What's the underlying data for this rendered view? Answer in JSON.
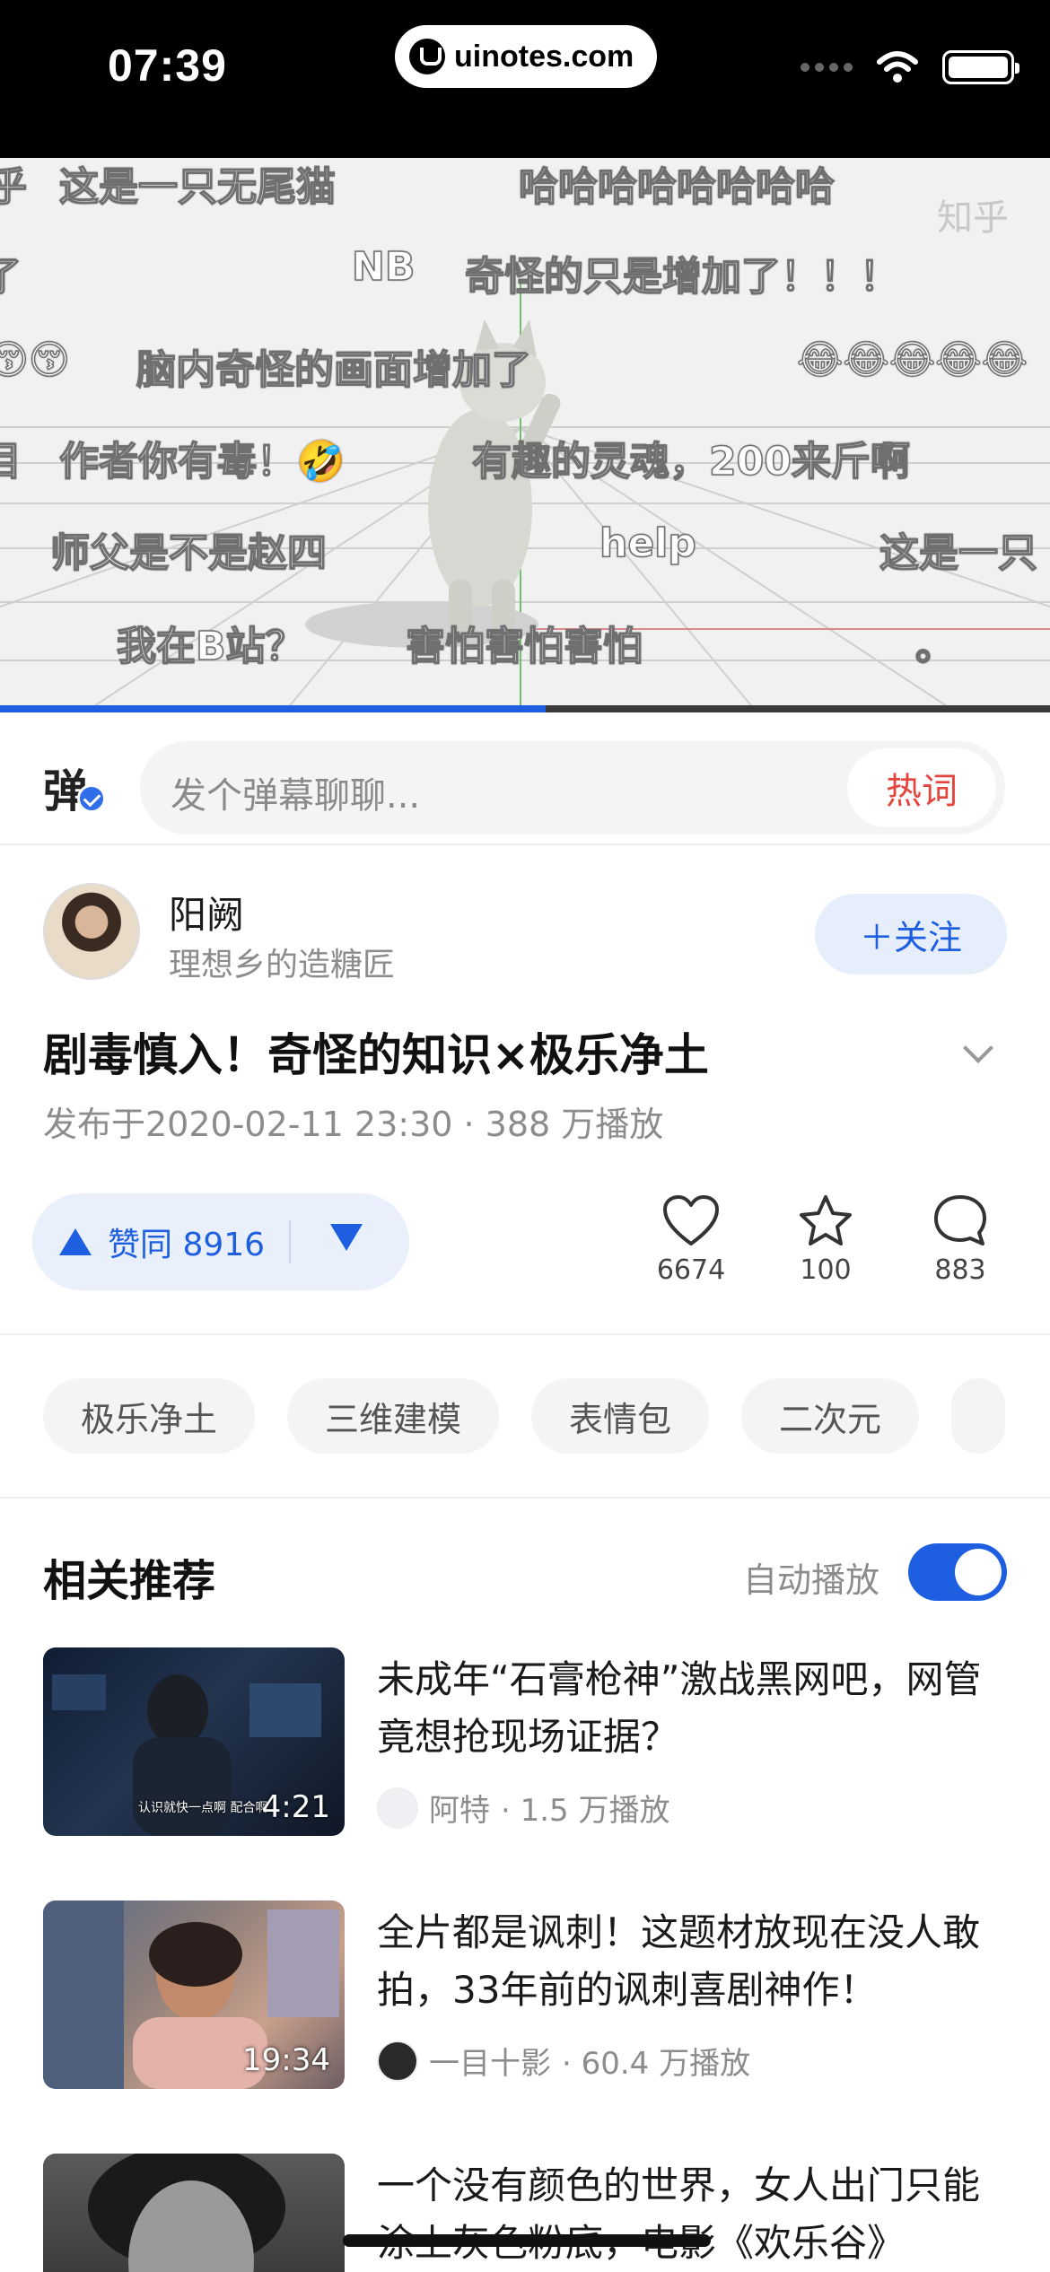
{
  "status_bar": {
    "time": "07:39",
    "url": "uinotes.com"
  },
  "video": {
    "watermark": "知乎",
    "progress_percent": 52,
    "danmaku": [
      "乎",
      "这是一只无尾猫",
      "哈哈哈哈哈哈哈哈",
      "了",
      "NB",
      "奇怪的只是增加了！！！",
      "😚😚",
      "脑内奇怪的画面增加了",
      "😂😂😂😂😂",
      "目",
      "作者你有毒！🤣",
      "有趣的灵魂，200来斤啊",
      "师父是不是赵四",
      "help",
      "这是一只",
      "我在B站？",
      "害怕害怕害怕",
      "。"
    ]
  },
  "danmu_bar": {
    "toggle_char": "弹",
    "placeholder": "发个弹幕聊聊...",
    "hot_label": "热词"
  },
  "author": {
    "name": "阳阙",
    "subtitle": "理想乡的造糖匠",
    "follow_label": "＋关注"
  },
  "post": {
    "title": "剧毒慎入！奇怪的知识×极乐净土",
    "meta": "发布于2020-02-11 23:30 · 388 万播放"
  },
  "actions": {
    "vote_label": "赞同 8916",
    "likes": "6674",
    "favorites": "100",
    "comments": "883"
  },
  "tags": [
    "极乐净土",
    "三维建模",
    "表情包",
    "二次元"
  ],
  "related": {
    "heading": "相关推荐",
    "autoplay_label": "自动播放",
    "autoplay_on": true,
    "items": [
      {
        "title": "未成年“石膏枪神”激战黑网吧，网管竟想抢现场证据？",
        "duration": "4:21",
        "subtitle": "认识就快一点啊 配合啊",
        "author": "阿特",
        "plays": "· 1.5 万播放"
      },
      {
        "title": "全片都是讽刺！这题材放现在没人敢拍，33年前的讽刺喜剧神作！",
        "duration": "19:34",
        "author": "一目十影",
        "plays": "· 60.4 万播放"
      },
      {
        "title": "一个没有颜色的世界，女人出门只能涂上灰色粉底，电影《欢乐谷》"
      }
    ]
  },
  "colors": {
    "accent": "#1d5fe0",
    "hot": "#e4463d"
  }
}
